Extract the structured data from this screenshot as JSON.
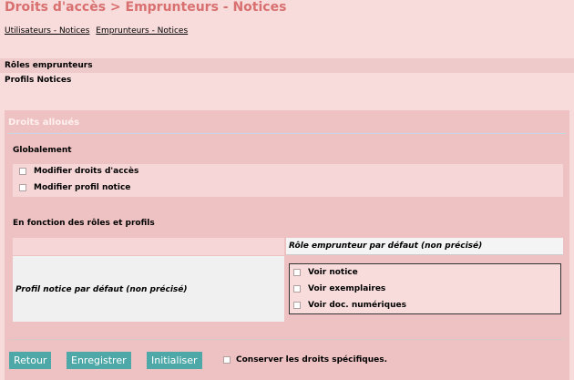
{
  "header": {
    "title": "Droits d'accès > Emprunteurs - Notices",
    "breadcrumb": [
      "Utilisateurs - Notices",
      "Emprunteurs - Notices"
    ]
  },
  "sections": {
    "roles_label": "Rôles emprunteurs",
    "profils_label": "Profils Notices"
  },
  "panel": {
    "title": "Droits alloués",
    "global": {
      "title": "Globalement",
      "options": [
        "Modifier droits d'accès",
        "Modifier profil notice"
      ]
    },
    "matrix": {
      "title": "En fonction des rôles et profils",
      "column_header": "Rôle emprunteur par défaut (non précisé)",
      "row_header": "Profil notice par défaut (non précisé)",
      "rights": [
        "Voir notice",
        "Voir exemplaires",
        "Voir doc. numériques"
      ]
    }
  },
  "actions": {
    "back": "Retour",
    "save": "Enregistrer",
    "init": "Initialiser",
    "keep_rights": "Conserver les droits spécifiques."
  },
  "colors": {
    "background": "#f8dcdc",
    "title": "#d87070",
    "button": "#4fa8a8"
  }
}
